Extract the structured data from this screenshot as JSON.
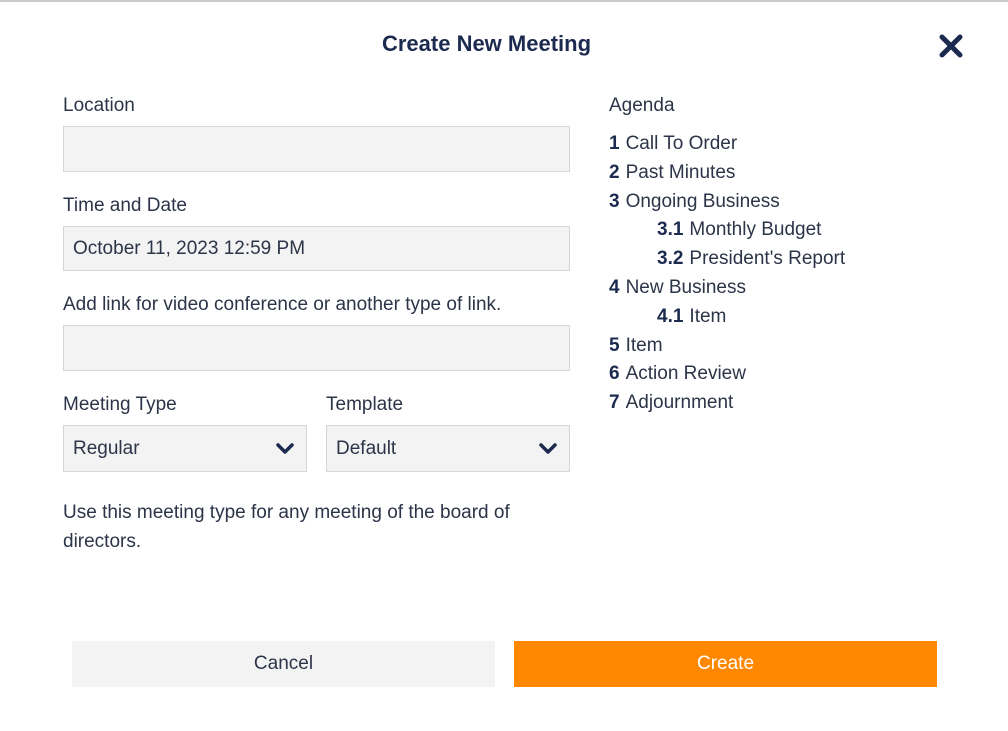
{
  "dialog": {
    "title": "Create New Meeting"
  },
  "form": {
    "location_label": "Location",
    "location_value": "",
    "time_label": "Time and Date",
    "time_value": "October 11, 2023 12:59 PM",
    "link_label": "Add link for video conference or another type of link.",
    "link_value": "",
    "meeting_type_label": "Meeting Type",
    "meeting_type_value": "Regular",
    "template_label": "Template",
    "template_value": "Default",
    "description": "Use this meeting type for any meeting of the board of directors."
  },
  "agenda": {
    "title": "Agenda",
    "items": [
      {
        "num": "1",
        "label": "Call To Order"
      },
      {
        "num": "2",
        "label": "Past Minutes"
      },
      {
        "num": "3",
        "label": "Ongoing Business"
      },
      {
        "num": "3.1",
        "label": "Monthly Budget"
      },
      {
        "num": "3.2",
        "label": "President's Report"
      },
      {
        "num": "4",
        "label": "New Business"
      },
      {
        "num": "4.1",
        "label": "Item"
      },
      {
        "num": "5",
        "label": "Item"
      },
      {
        "num": "6",
        "label": "Action Review"
      },
      {
        "num": "7",
        "label": "Adjournment"
      }
    ]
  },
  "actions": {
    "cancel_label": "Cancel",
    "create_label": "Create"
  },
  "colors": {
    "accent": "#ff8800",
    "title": "#1b2a4e",
    "field_bg": "#f3f3f3"
  },
  "icons": {
    "close": "close-icon",
    "select_arrow": "chevron-down-icon"
  }
}
